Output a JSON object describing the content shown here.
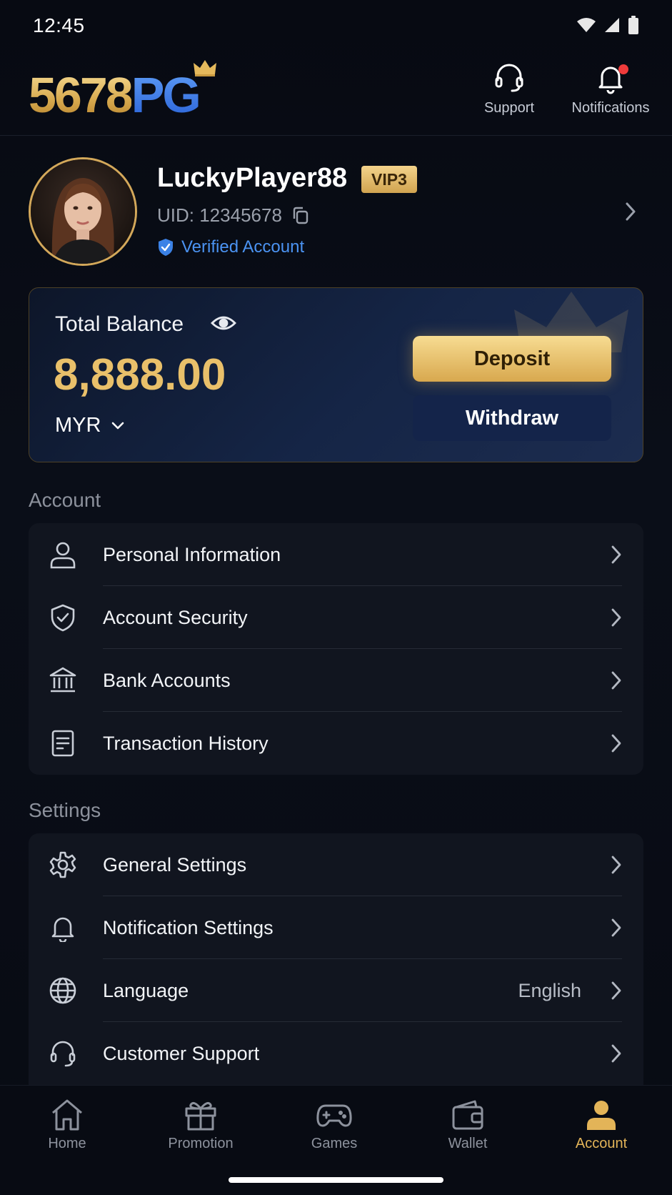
{
  "status_bar": {
    "time": "12:45"
  },
  "header": {
    "logo_num": "5678",
    "logo_pg": "PG",
    "support_label": "Support",
    "notifications_label": "Notifications"
  },
  "profile": {
    "username": "LuckyPlayer88",
    "vip": "VIP3",
    "uid": "UID: 12345678",
    "verified": "Verified Account"
  },
  "balance": {
    "label": "Total Balance",
    "amount": "8,888.00",
    "currency": "MYR",
    "deposit_label": "Deposit",
    "withdraw_label": "Withdraw"
  },
  "account_section": {
    "title": "Account",
    "items": [
      {
        "label": "Personal Information",
        "icon": "person-icon"
      },
      {
        "label": "Account Security",
        "icon": "shield-check-icon"
      },
      {
        "label": "Bank Accounts",
        "icon": "bank-icon"
      },
      {
        "label": "Transaction History",
        "icon": "document-icon"
      }
    ]
  },
  "settings_section": {
    "title": "Settings",
    "items": [
      {
        "label": "General Settings",
        "icon": "gear-icon"
      },
      {
        "label": "Notification Settings",
        "icon": "bell-icon"
      },
      {
        "label": "Language",
        "icon": "globe-icon",
        "value": "English"
      },
      {
        "label": "Customer Support",
        "icon": "headset-icon"
      }
    ]
  },
  "bottom_nav": {
    "items": [
      {
        "label": "Home",
        "icon": "home-icon"
      },
      {
        "label": "Promotion",
        "icon": "gift-icon"
      },
      {
        "label": "Games",
        "icon": "gamepad-icon"
      },
      {
        "label": "Wallet",
        "icon": "wallet-icon"
      },
      {
        "label": "Account",
        "icon": "account-icon",
        "active": true
      }
    ]
  },
  "colors": {
    "gold": "#e3b458",
    "blue_accent": "#4b93f2",
    "background": "#080b13",
    "card": "#11151f"
  }
}
